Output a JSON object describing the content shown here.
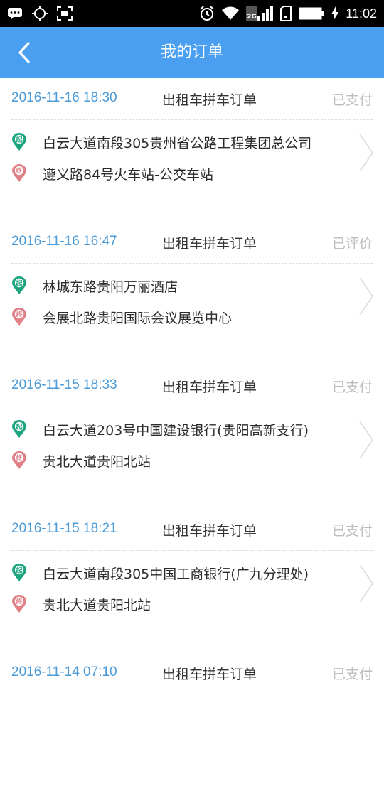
{
  "status_bar": {
    "time": "11:02",
    "network": "2G",
    "icons": [
      "message-icon",
      "gps-icon",
      "screenshot-icon",
      "alarm-icon",
      "wifi-icon",
      "signal-icon",
      "sim-icon",
      "battery-icon",
      "charging-icon"
    ]
  },
  "header": {
    "title": "我的订单",
    "back_icon": "chevron-left-icon",
    "background": "#4a9ff0"
  },
  "colors": {
    "time_text": "#4a9ad8",
    "status_text": "#bdbdbd",
    "start_pin": "#1aa57e",
    "end_pin": "#e07f86"
  },
  "orders": [
    {
      "time": "2016-11-16 18:30",
      "type": "出租车拼车订单",
      "status": "已支付",
      "start_badge": "起",
      "start": "白云大道南段305贵州省公路工程集团总公司",
      "end_badge": "终",
      "end": "遵义路84号火车站-公交车站"
    },
    {
      "time": "2016-11-16 16:47",
      "type": "出租车拼车订单",
      "status": "已评价",
      "start_badge": "起",
      "start": "林城东路贵阳万丽酒店",
      "end_badge": "终",
      "end": "会展北路贵阳国际会议展览中心"
    },
    {
      "time": "2016-11-15 18:33",
      "type": "出租车拼车订单",
      "status": "已支付",
      "start_badge": "起",
      "start": "白云大道203号中国建设银行(贵阳高新支行)",
      "end_badge": "终",
      "end": "贵北大道贵阳北站"
    },
    {
      "time": "2016-11-15 18:21",
      "type": "出租车拼车订单",
      "status": "已支付",
      "start_badge": "起",
      "start": "白云大道南段305中国工商银行(广九分理处)",
      "end_badge": "终",
      "end": "贵北大道贵阳北站"
    },
    {
      "time": "2016-11-14 07:10",
      "type": "出租车拼车订单",
      "status": "已支付"
    }
  ]
}
